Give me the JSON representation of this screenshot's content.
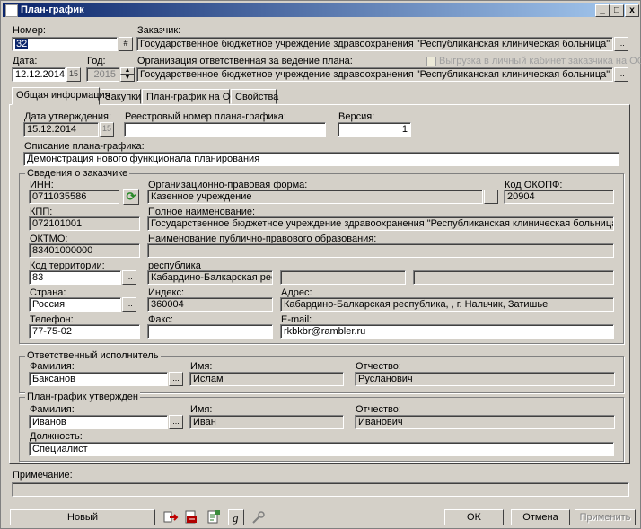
{
  "window": {
    "title": "План-график",
    "min": "_",
    "max": "□",
    "close": "x"
  },
  "header": {
    "number_label": "Номер:",
    "number_value": "32",
    "customer_label": "Заказчик:",
    "customer_value": "Государственное бюджетное учреждение здравоохранения \"Республиканская клиническая больница\" Министерства здра",
    "date_label": "Дата:",
    "date_value": "12.12.2014",
    "year_label": "Год:",
    "year_value": "2015",
    "org_label": "Организация ответственная за ведение плана:",
    "org_value": "Государственное бюджетное учреждение здравоохранения \"Республиканская клиническая больница\" Министерства здра",
    "upload_label": "Выгрузка в личный кабинет заказчика на ООС",
    "ellipsis": "...",
    "hash": "#",
    "cal": "15"
  },
  "tabs": [
    "Общая информация",
    "Закупки",
    "План-график на ООС",
    "Свойства"
  ],
  "general": {
    "approve_date_label": "Дата утверждения:",
    "approve_date_value": "15.12.2014",
    "reg_number_label": "Реестровый номер плана-графика:",
    "reg_number_value": "",
    "version_label": "Версия:",
    "version_value": "1",
    "description_label": "Описание плана-графика:",
    "description_value": "Демонстрация нового функционала планирования"
  },
  "customer_info": {
    "group_title": "Сведения о заказчике",
    "inn_label": "ИНН:",
    "inn_value": "0711035586",
    "opf_label": "Организационно-правовая форма:",
    "opf_value": "Казенное учреждение",
    "okopf_label": "Код ОКОПФ:",
    "okopf_value": "20904",
    "kpp_label": "КПП:",
    "kpp_value": "072101001",
    "fullname_label": "Полное наименование:",
    "fullname_value": "Государственное бюджетное учреждение здравоохранения \"Республиканская клиническая больница\" Министерства зд",
    "oktmo_label": "ОКТМО:",
    "oktmo_value": "83401000000",
    "ppo_label": "Наименование публично-правового образования:",
    "ppo_value": "",
    "territory_label": "Код территории:",
    "territory_value": "83",
    "republic_label": "республика",
    "republic_value": "Кабардино-Балкарская респуб",
    "country_label": "Страна:",
    "country_value": "Россия",
    "index_label": "Индекс:",
    "index_value": "360004",
    "address_label": "Адрес:",
    "address_value": "Кабардино-Балкарская республика, , г. Нальчик, Затишье",
    "phone_label": "Телефон:",
    "phone_value": "77-75-02",
    "fax_label": "Факс:",
    "fax_value": "",
    "email_label": "E-mail:",
    "email_value": "rkbkbr@rambler.ru"
  },
  "responsible": {
    "group_title": "Ответственный исполнитель",
    "last_label": "Фамилия:",
    "last_value": "Баксанов",
    "first_label": "Имя:",
    "first_value": "Ислам",
    "middle_label": "Отчество:",
    "middle_value": "Русланович"
  },
  "approved": {
    "group_title": "План-график утвержден",
    "last_label": "Фамилия:",
    "last_value": "Иванов",
    "first_label": "Имя:",
    "first_value": "Иван",
    "middle_label": "Отчество:",
    "middle_value": "Иванович",
    "position_label": "Должность:",
    "position_value": "Специалист"
  },
  "note": {
    "label": "Примечание:",
    "value": ""
  },
  "footer": {
    "new_label": "Новый",
    "ok_label": "OK",
    "cancel_label": "Отмена",
    "apply_label": "Применить"
  }
}
